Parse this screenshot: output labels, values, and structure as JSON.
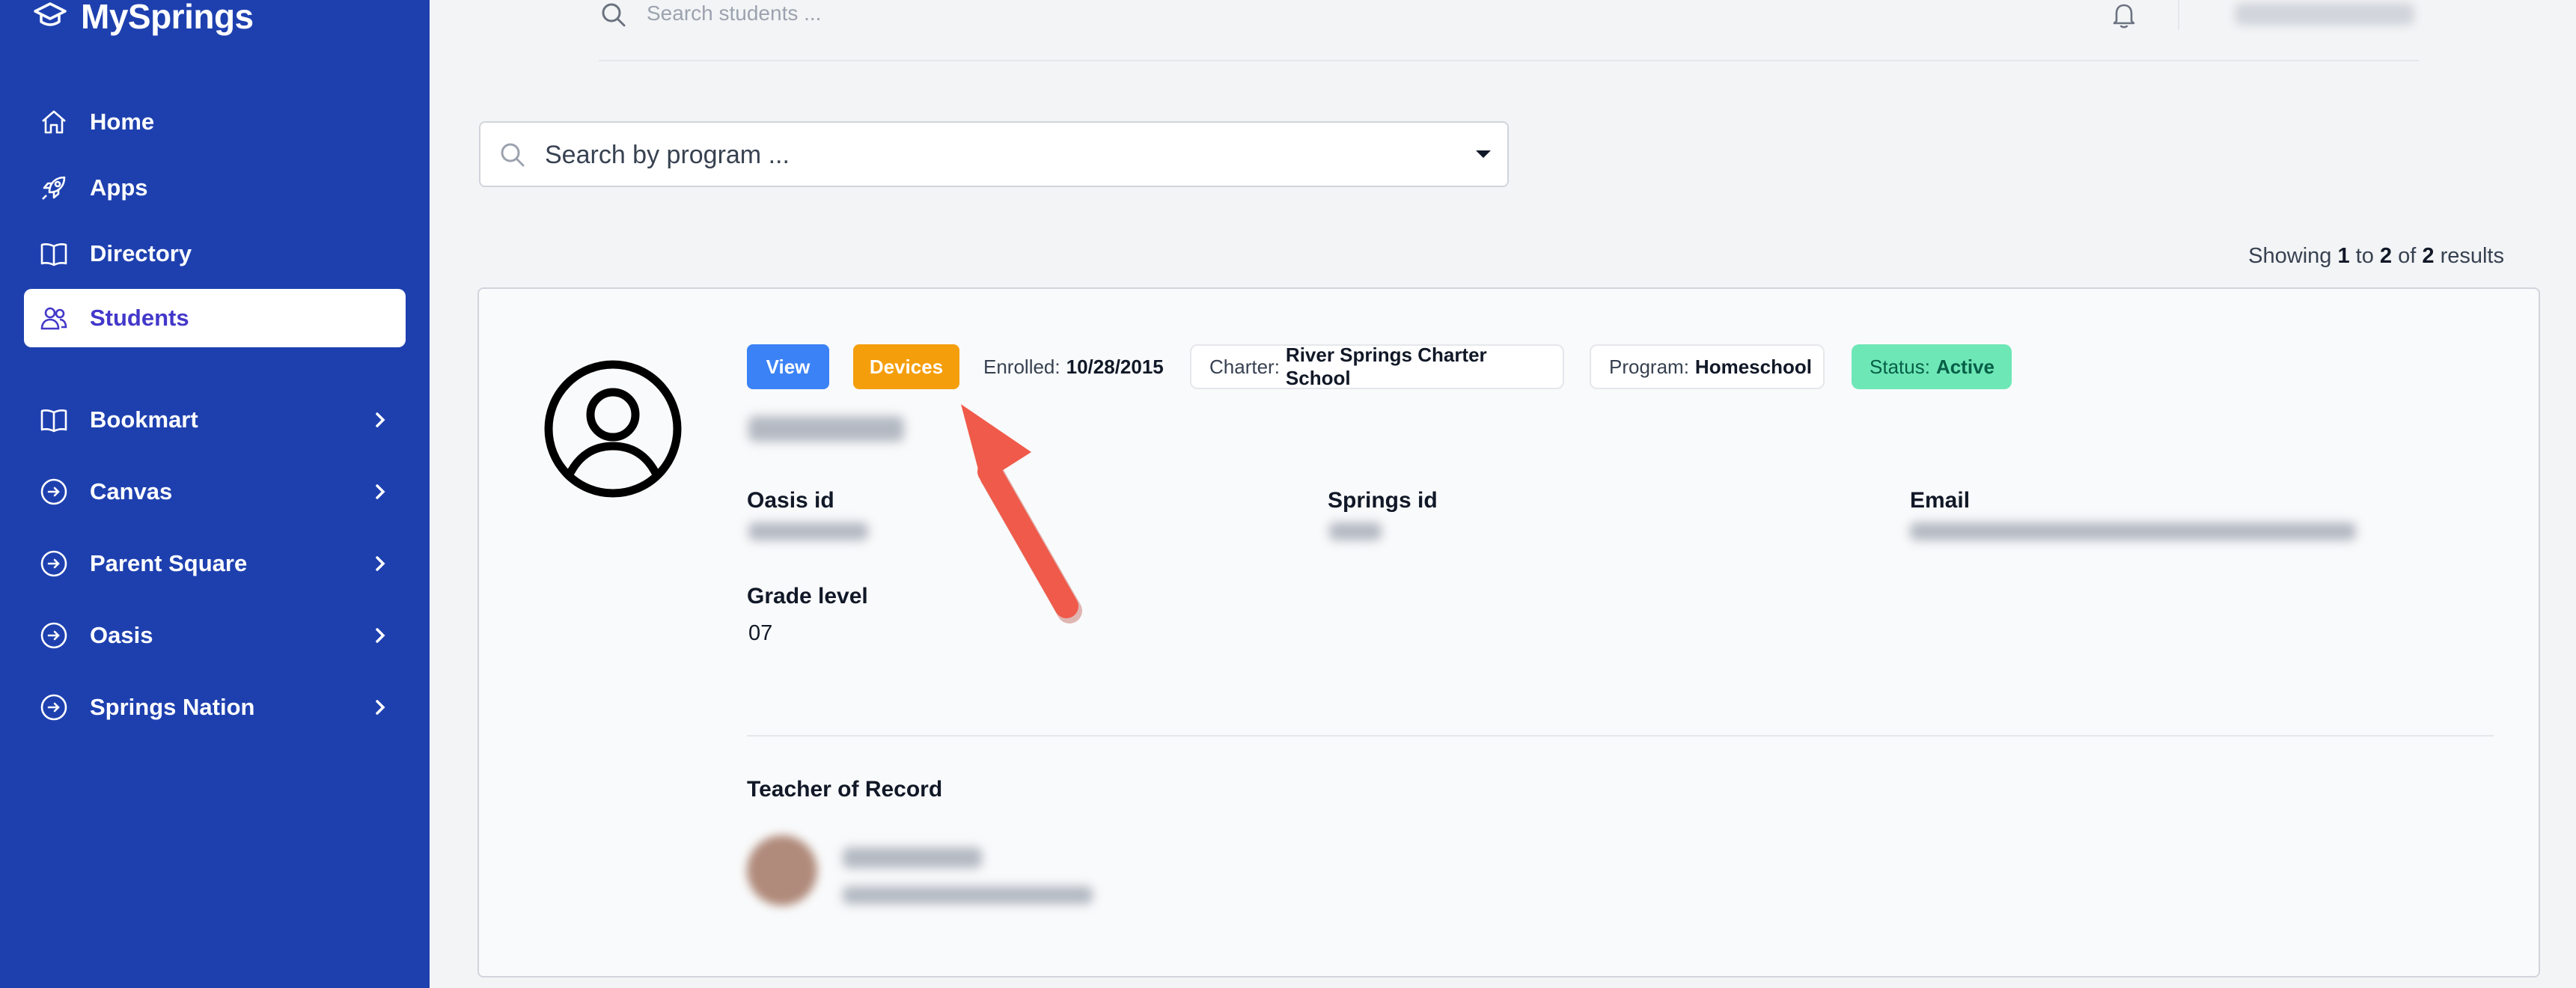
{
  "app": {
    "name": "MySprings"
  },
  "topbar": {
    "search_placeholder": "Search students ..."
  },
  "sidebar": {
    "items": [
      {
        "label": "Home",
        "icon": "home-icon"
      },
      {
        "label": "Apps",
        "icon": "rocket-icon"
      },
      {
        "label": "Directory",
        "icon": "book-open-icon"
      },
      {
        "label": "Students",
        "icon": "users-icon",
        "active": true
      },
      {
        "label": "Bookmart",
        "icon": "book-open-icon",
        "expandable": true
      },
      {
        "label": "Canvas",
        "icon": "arrow-circle-right-icon",
        "expandable": true
      },
      {
        "label": "Parent Square",
        "icon": "arrow-circle-right-icon",
        "expandable": true
      },
      {
        "label": "Oasis",
        "icon": "arrow-circle-right-icon",
        "expandable": true
      },
      {
        "label": "Springs Nation",
        "icon": "arrow-circle-right-icon",
        "expandable": true
      }
    ]
  },
  "program_search": {
    "placeholder": "Search by program ..."
  },
  "results": {
    "prefix": "Showing",
    "from": "1",
    "to_word": "to",
    "to": "2",
    "of_word": "of",
    "total": "2",
    "suffix": "results"
  },
  "student": {
    "buttons": {
      "view": "View",
      "devices": "Devices"
    },
    "enrolled": {
      "label": "Enrolled:",
      "value": "10/28/2015"
    },
    "charter": {
      "label": "Charter:",
      "value": "River Springs Charter School"
    },
    "program": {
      "label": "Program:",
      "value": "Homeschool"
    },
    "status": {
      "label": "Status:",
      "value": "Active"
    },
    "fields": {
      "oasis_id_label": "Oasis id",
      "springs_id_label": "Springs id",
      "email_label": "Email",
      "grade_level_label": "Grade level",
      "grade_level_value": "07"
    },
    "teacher_section": {
      "label": "Teacher of Record"
    }
  },
  "colors": {
    "sidebar_bg": "#1e40af",
    "active_text": "#4338ca",
    "view_button": "#3b82f6",
    "devices_button": "#f59e0b",
    "status_active": "#6ee7b7",
    "annotation_arrow": "#f05a4a"
  }
}
